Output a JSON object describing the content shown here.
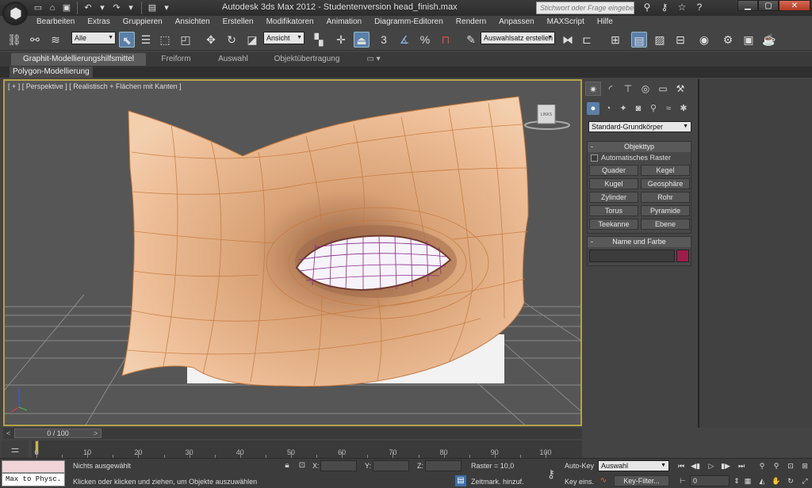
{
  "titlebar": {
    "app_title": "Autodesk 3ds Max  2012  - Studentenversion    head_finish.max",
    "search_placeholder": "Stichwort oder Frage eingeben",
    "help_icon": "?"
  },
  "menu": [
    "Bearbeiten",
    "Extras",
    "Gruppieren",
    "Ansichten",
    "Erstellen",
    "Modifikatoren",
    "Animation",
    "Diagramm-Editoren",
    "Rendern",
    "Anpassen",
    "MAXScript",
    "Hilfe"
  ],
  "toolbar": {
    "selection_filter": "Alle",
    "ref_coord": "Ansicht",
    "snap_value": "3",
    "named_selection": "Auswahlsatz erstellen"
  },
  "ribbon": {
    "tabs": [
      "Graphit-Modellierungshilfsmittel",
      "Freiform",
      "Auswahl",
      "Objektübertragung"
    ],
    "subtab": "Polygon-Modellierung"
  },
  "viewport": {
    "label": "[ + ] [ Perspektive ] [ Realistisch + Flächen mit Kanten ]",
    "viewcube_label": "LINKS"
  },
  "command_panel": {
    "category": "Standard-Grundkörper",
    "rollout_object_type": {
      "title": "Objekttyp",
      "autogrid_label": "Automatisches Raster",
      "buttons": [
        "Quader",
        "Kegel",
        "Kugel",
        "Geosphäre",
        "Zylinder",
        "Rohr",
        "Torus",
        "Pyramide",
        "Teekanne",
        "Ebene"
      ]
    },
    "rollout_name_color": {
      "title": "Name und Farbe"
    }
  },
  "timeline": {
    "frame_display": "0 / 100",
    "ticks": [
      "0",
      "10",
      "20",
      "30",
      "40",
      "50",
      "60",
      "70",
      "80",
      "90",
      "100"
    ]
  },
  "statusbar": {
    "maxscript_text": "Max to Physc.",
    "selection_status": "Nichts ausgewählt",
    "prompt": "Klicken oder klicken und ziehen, um Objekte auszuwählen",
    "x_label": "X:",
    "y_label": "Y:",
    "z_label": "Z:",
    "grid_label": "Raster = 10,0",
    "time_tag": "Zeitmark. hinzuf.",
    "autokey": "Auto-Key",
    "setkey": "Key eins.",
    "key_mode": "Auswahl",
    "key_filters": "Key-Filter...",
    "current_frame": "0"
  },
  "colors": {
    "viewport_border": "#b3a24a",
    "skin": "#e7b78a",
    "wireframe": "#c67a3f",
    "eye_wire": "#8a2a8a",
    "name_color_swatch": "#9c1d49"
  }
}
